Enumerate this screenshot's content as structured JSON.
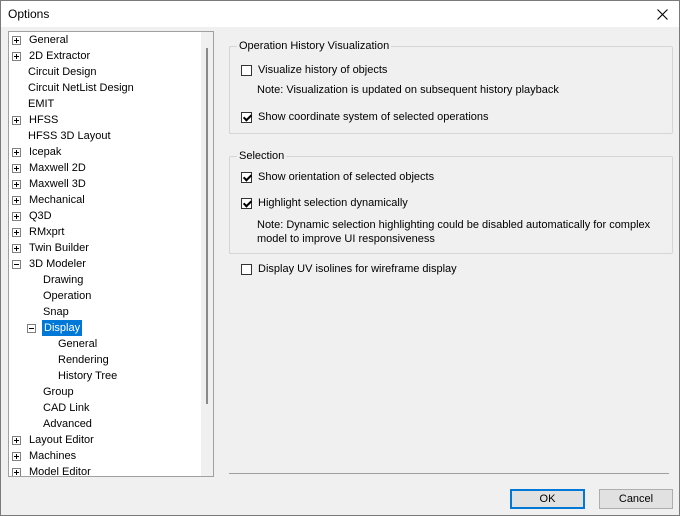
{
  "window": {
    "title": "Options"
  },
  "tree": [
    {
      "label": "General",
      "depth": 0,
      "expander": "plus"
    },
    {
      "label": "2D Extractor",
      "depth": 0,
      "expander": "plus"
    },
    {
      "label": "Circuit Design",
      "depth": 0,
      "expander": "none"
    },
    {
      "label": "Circuit NetList Design",
      "depth": 0,
      "expander": "none"
    },
    {
      "label": "EMIT",
      "depth": 0,
      "expander": "none"
    },
    {
      "label": "HFSS",
      "depth": 0,
      "expander": "plus"
    },
    {
      "label": "HFSS 3D Layout",
      "depth": 0,
      "expander": "none"
    },
    {
      "label": "Icepak",
      "depth": 0,
      "expander": "plus"
    },
    {
      "label": "Maxwell 2D",
      "depth": 0,
      "expander": "plus"
    },
    {
      "label": "Maxwell 3D",
      "depth": 0,
      "expander": "plus"
    },
    {
      "label": "Mechanical",
      "depth": 0,
      "expander": "plus"
    },
    {
      "label": "Q3D",
      "depth": 0,
      "expander": "plus"
    },
    {
      "label": "RMxprt",
      "depth": 0,
      "expander": "plus"
    },
    {
      "label": "Twin Builder",
      "depth": 0,
      "expander": "plus"
    },
    {
      "label": "3D Modeler",
      "depth": 0,
      "expander": "minus"
    },
    {
      "label": "Drawing",
      "depth": 1,
      "expander": "none"
    },
    {
      "label": "Operation",
      "depth": 1,
      "expander": "none"
    },
    {
      "label": "Snap",
      "depth": 1,
      "expander": "none"
    },
    {
      "label": "Display",
      "depth": 1,
      "expander": "minus",
      "selected": true
    },
    {
      "label": "General",
      "depth": 2,
      "expander": "none"
    },
    {
      "label": "Rendering",
      "depth": 2,
      "expander": "none"
    },
    {
      "label": "History Tree",
      "depth": 2,
      "expander": "none"
    },
    {
      "label": "Group",
      "depth": 1,
      "expander": "none"
    },
    {
      "label": "CAD Link",
      "depth": 1,
      "expander": "none"
    },
    {
      "label": "Advanced",
      "depth": 1,
      "expander": "none"
    },
    {
      "label": "Layout Editor",
      "depth": 0,
      "expander": "plus"
    },
    {
      "label": "Machines",
      "depth": 0,
      "expander": "plus"
    },
    {
      "label": "Model Editor",
      "depth": 0,
      "expander": "plus"
    }
  ],
  "history_group": {
    "title": "Operation History Visualization",
    "visualize_history": {
      "label": "Visualize history of objects",
      "checked": false
    },
    "note": "Note: Visualization is updated on subsequent history playback",
    "show_coordinate": {
      "label": "Show coordinate system of selected operations",
      "checked": true
    }
  },
  "selection_group": {
    "title": "Selection",
    "show_orientation": {
      "label": "Show orientation of selected objects",
      "checked": true
    },
    "highlight_dynamic": {
      "label": "Highlight selection dynamically",
      "checked": true
    },
    "note_line1": "Note: Dynamic selection highlighting could be disabled automatically for complex",
    "note_line2": "model to improve UI responsiveness"
  },
  "uv_isolines": {
    "label": "Display UV isolines for wireframe display",
    "checked": false
  },
  "buttons": {
    "ok": "OK",
    "cancel": "Cancel"
  }
}
